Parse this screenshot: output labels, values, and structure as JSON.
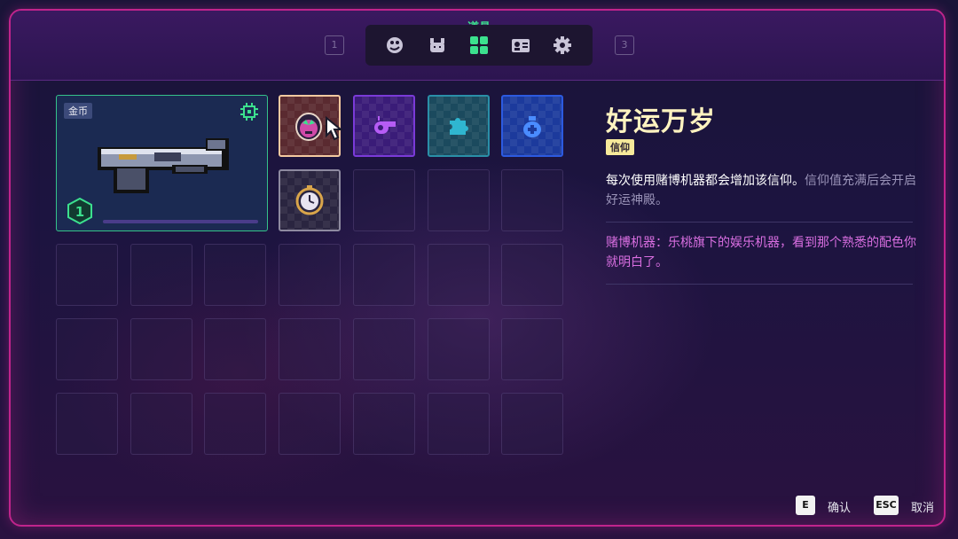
{
  "header": {
    "active_tab_label": "道具",
    "page_left": "1",
    "page_right": "3",
    "tabs": [
      {
        "icon": "palette-icon"
      },
      {
        "icon": "pet-icon"
      },
      {
        "icon": "items-grid-icon",
        "active": true
      },
      {
        "icon": "character-card-icon"
      },
      {
        "icon": "gear-icon"
      }
    ]
  },
  "weapon": {
    "currency_tag": "金币",
    "level": "1",
    "icon": "pistol-icon"
  },
  "items": [
    {
      "icon": "mask-icon",
      "border": "#f3c9a0",
      "bg": "#5a2a30"
    },
    {
      "icon": "whistle-icon",
      "border": "#7a3ad8",
      "bg": "#3a1c78"
    },
    {
      "icon": "puzzle-icon",
      "border": "#2a8fa8",
      "bg": "#1b4a5e"
    },
    {
      "icon": "money-bag-icon",
      "border": "#2c5ae0",
      "bg": "#1c3a9c"
    },
    {
      "icon": "pocket-watch-icon",
      "border": "#8e8aa0",
      "bg": "#2a2540"
    }
  ],
  "detail": {
    "title": "好运万岁",
    "tag": "信仰",
    "desc_main": "每次使用赌博机器都会增加该信仰。",
    "desc_sub": "信仰值充满后会开启好运神殿。",
    "lore": "赌博机器：乐桃旗下的娱乐机器，看到那个熟悉的配色你就明白了。"
  },
  "footer": {
    "confirm_key": "E",
    "confirm_label": "确认",
    "cancel_key": "ESC",
    "cancel_label": "取消"
  },
  "colors": {
    "frame": "#c0248c",
    "active_tab": "#3ce08e",
    "title": "#fff3c0",
    "lore": "#d86ee0"
  }
}
